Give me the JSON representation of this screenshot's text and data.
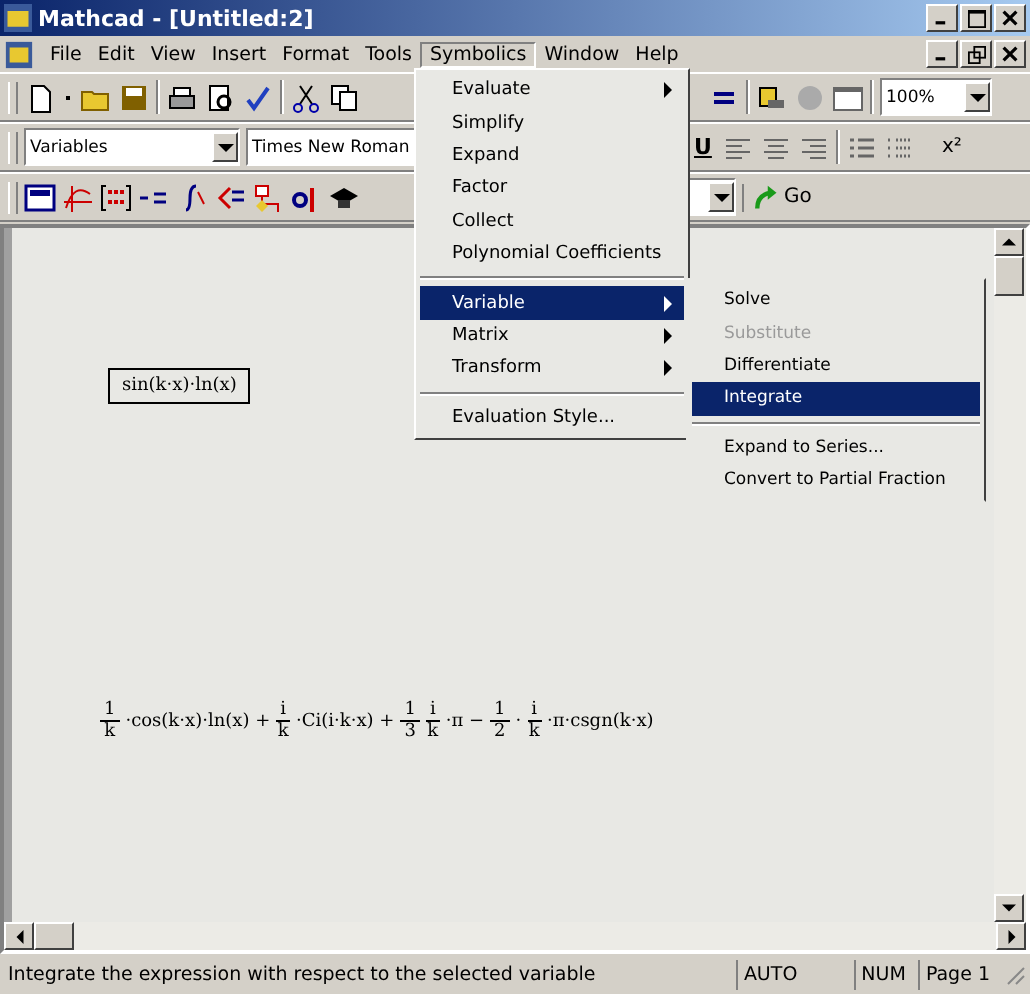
{
  "window": {
    "title": "Mathcad - [Untitled:2]"
  },
  "menubar": [
    {
      "label": "File",
      "selected": false
    },
    {
      "label": "Edit",
      "selected": false
    },
    {
      "label": "View",
      "selected": false
    },
    {
      "label": "Insert",
      "selected": false
    },
    {
      "label": "Format",
      "selected": false
    },
    {
      "label": "Tools",
      "selected": false
    },
    {
      "label": "Symbolics",
      "selected": true
    },
    {
      "label": "Window",
      "selected": false
    },
    {
      "label": "Help",
      "selected": false
    }
  ],
  "toolbar": {
    "zoom": "100%"
  },
  "format_bar": {
    "style": "Variables",
    "font": "Times New Roman",
    "underline": "U",
    "superscript": "x²"
  },
  "math_bar": {
    "go": "Go"
  },
  "menu": [
    {
      "kind": "item",
      "label": "Evaluate",
      "submenu": true,
      "selected": false
    },
    {
      "kind": "item",
      "label": "Simplify",
      "submenu": false,
      "selected": false
    },
    {
      "kind": "item",
      "label": "Expand",
      "submenu": false,
      "selected": false
    },
    {
      "kind": "item",
      "label": "Factor",
      "submenu": false,
      "selected": false
    },
    {
      "kind": "item",
      "label": "Collect",
      "submenu": false,
      "selected": false
    },
    {
      "kind": "item",
      "label": "Polynomial Coefficients",
      "submenu": false,
      "selected": false
    },
    {
      "kind": "separator"
    },
    {
      "kind": "item",
      "label": "Variable",
      "submenu": true,
      "selected": true
    },
    {
      "kind": "item",
      "label": "Matrix",
      "submenu": true,
      "selected": false
    },
    {
      "kind": "item",
      "label": "Transform",
      "submenu": true,
      "selected": false
    },
    {
      "kind": "separator"
    },
    {
      "kind": "item",
      "label": "Evaluation Style...",
      "submenu": false,
      "selected": false
    }
  ],
  "submenu": [
    {
      "kind": "item",
      "label": "Solve",
      "disabled": false,
      "selected": false
    },
    {
      "kind": "item",
      "label": "Substitute",
      "disabled": true,
      "selected": false
    },
    {
      "kind": "item",
      "label": "Differentiate",
      "disabled": false,
      "selected": false
    },
    {
      "kind": "item",
      "label": "Integrate",
      "disabled": false,
      "selected": true
    },
    {
      "kind": "separator"
    },
    {
      "kind": "item",
      "label": "Expand to Series...",
      "disabled": false,
      "selected": false
    },
    {
      "kind": "item",
      "label": "Convert to Partial Fraction",
      "disabled": false,
      "selected": false
    }
  ],
  "worksheet": {
    "expression": "sin(k·x)·ln(x)",
    "result": [
      {
        "kind": "frac",
        "num": "1",
        "den": "k"
      },
      {
        "kind": "text",
        "text": "·cos(k·x)·ln(x) +"
      },
      {
        "kind": "frac",
        "num": "i",
        "den": "k"
      },
      {
        "kind": "text",
        "text": "·Ci(i·k·x) +"
      },
      {
        "kind": "frac",
        "num": "1",
        "den": "3"
      },
      {
        "kind": "frac",
        "num": "i",
        "den": "k"
      },
      {
        "kind": "text",
        "text": "·π −"
      },
      {
        "kind": "frac",
        "num": "1",
        "den": "2"
      },
      {
        "kind": "text",
        "text": "·"
      },
      {
        "kind": "frac",
        "num": "i",
        "den": "k"
      },
      {
        "kind": "text",
        "text": "·π·csgn(k·x)"
      }
    ]
  },
  "status_bar": {
    "message": "Integrate the expression with respect to the selected variable",
    "mode": "AUTO",
    "num": "NUM",
    "page": "Page 1"
  }
}
